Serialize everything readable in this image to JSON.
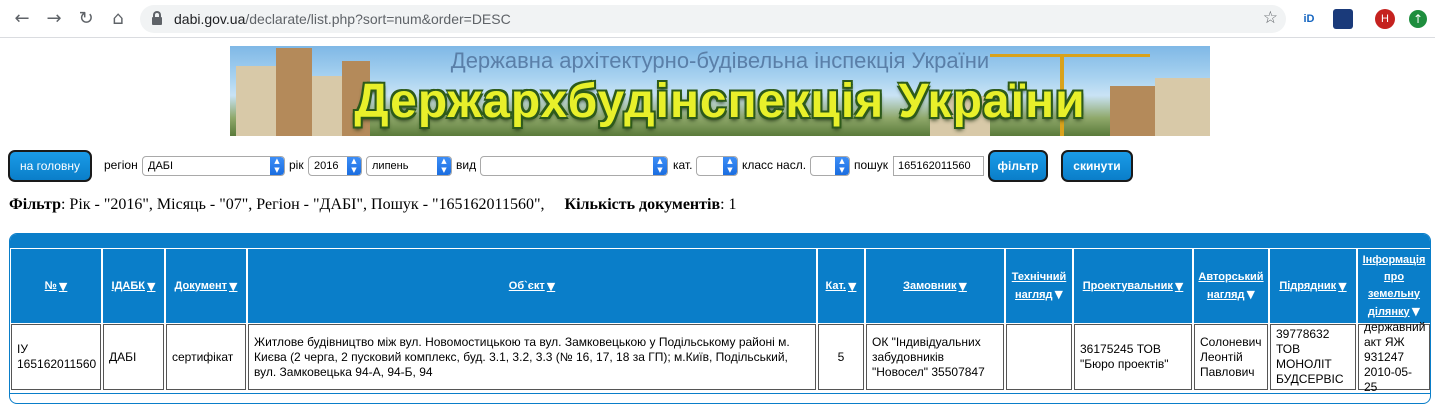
{
  "browser": {
    "back_icon": "arrow-left-icon",
    "forward_icon": "arrow-right-icon",
    "reload_icon": "reload-icon",
    "home_icon": "home-icon",
    "url_host": "dabi.gov.ua",
    "url_path": "/declarate/list.php?sort=num&order=DESC",
    "ext1_label": "iD",
    "avatar_letter": "H"
  },
  "banner": {
    "subtitle": "Державна архітектурно-будівельна інспекція України",
    "title": "Держархбудінспекція України"
  },
  "filters": {
    "home_button": "на головну",
    "region_label": "регіон",
    "region_value": "ДАБІ",
    "year_label": "рік",
    "year_value": "2016",
    "month_value": "липень",
    "type_label": "вид",
    "type_value": "",
    "cat_label": "кат.",
    "cat_value": "",
    "class_label": "класс насл.",
    "class_value": "",
    "search_label": "пошук",
    "search_value": "165162011560",
    "filter_button": "фільтр",
    "reset_button": "скинути"
  },
  "summary": {
    "filter_label": "Фільтр",
    "filter_text": ": Рік - \"2016\", Місяць - \"07\", Регіон - \"ДАБІ\", Пошук - \"165162011560\",",
    "count_label": "Кількість документів",
    "count_value": ": 1"
  },
  "table": {
    "headers": {
      "num": "№",
      "idabk": "ІДАБК",
      "doc": "Документ",
      "object": "Об`єкт",
      "cat": "Кат.",
      "customer": "Замовник",
      "tech_1": "Технічний",
      "tech_2": "нагляд",
      "designer": "Проектувальник",
      "author_1": "Авторський",
      "author_2": "нагляд",
      "contractor": "Підрядник",
      "land_1": "Інформація",
      "land_2": "про",
      "land_3": "земельну",
      "land_4": "ділянку"
    },
    "row": {
      "num_1": "ІУ",
      "num_2": "165162011560",
      "idabk": "ДАБІ",
      "doc": "сертифікат",
      "object_1": "Житлове будівництво між вул. Новомостицькою та вул. Замковецькою у Подільському районі м.",
      "object_2": "Києва (2 черга, 2 пусковий комплекс, буд. 3.1, 3.2, 3.3 (№ 16, 17, 18 за ГП); м.Київ, Подільський,",
      "object_3": "вул. Замковецька 94-А, 94-Б, 94",
      "cat": "5",
      "customer_1": "ОК \"Індивідуальних",
      "customer_2": "забудовників",
      "customer_3": "\"Новосел\" 35507847",
      "tech": "",
      "designer_1": "36175245 ТОВ",
      "designer_2": "\"Бюро проектів\"",
      "author_1": "Солоневич",
      "author_2": "Леонтій",
      "author_3": "Павлович",
      "contractor_1": "39778632",
      "contractor_2": "ТОВ",
      "contractor_3": "МОНОЛІТ",
      "contractor_4": "БУДСЕРВІС",
      "land_1": "державний",
      "land_2": "акт ЯЖ",
      "land_3": "931247",
      "land_4": "2010-05-25"
    }
  },
  "colors": {
    "accent": "#0a7ec9",
    "button_border": "#1a1a1a"
  }
}
